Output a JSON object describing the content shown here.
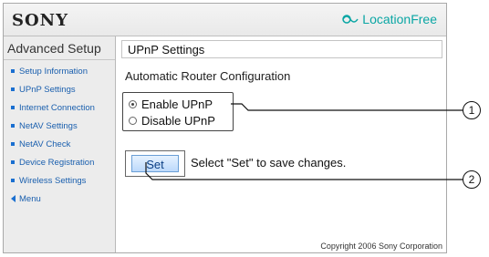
{
  "header": {
    "brand": "SONY",
    "logo_text": "LocationFree",
    "logo_icon": "locationfree-icon"
  },
  "sidebar": {
    "title": "Advanced Setup",
    "items": [
      {
        "label": "Setup Information",
        "icon": "bullet"
      },
      {
        "label": "UPnP Settings",
        "icon": "bullet"
      },
      {
        "label": "Internet Connection",
        "icon": "bullet"
      },
      {
        "label": "NetAV Settings",
        "icon": "bullet"
      },
      {
        "label": "NetAV Check",
        "icon": "bullet"
      },
      {
        "label": "Device Registration",
        "icon": "bullet"
      },
      {
        "label": "Wireless Settings",
        "icon": "bullet"
      },
      {
        "label": "Menu",
        "icon": "back-arrow"
      }
    ]
  },
  "main": {
    "title": "UPnP Settings",
    "section_label": "Automatic Router Configuration",
    "radios": [
      {
        "label": "Enable UPnP",
        "checked": true
      },
      {
        "label": "Disable UPnP",
        "checked": false
      }
    ],
    "set_label": "Set",
    "set_hint": "Select \"Set\" to save changes."
  },
  "footer": {
    "copyright": "Copyright 2006 Sony Corporation"
  },
  "callouts": [
    {
      "label": "1"
    },
    {
      "label": "2"
    }
  ],
  "colors": {
    "link": "#1a5fae",
    "logo": "#0aa6a4",
    "button_text": "#0b3f85"
  }
}
